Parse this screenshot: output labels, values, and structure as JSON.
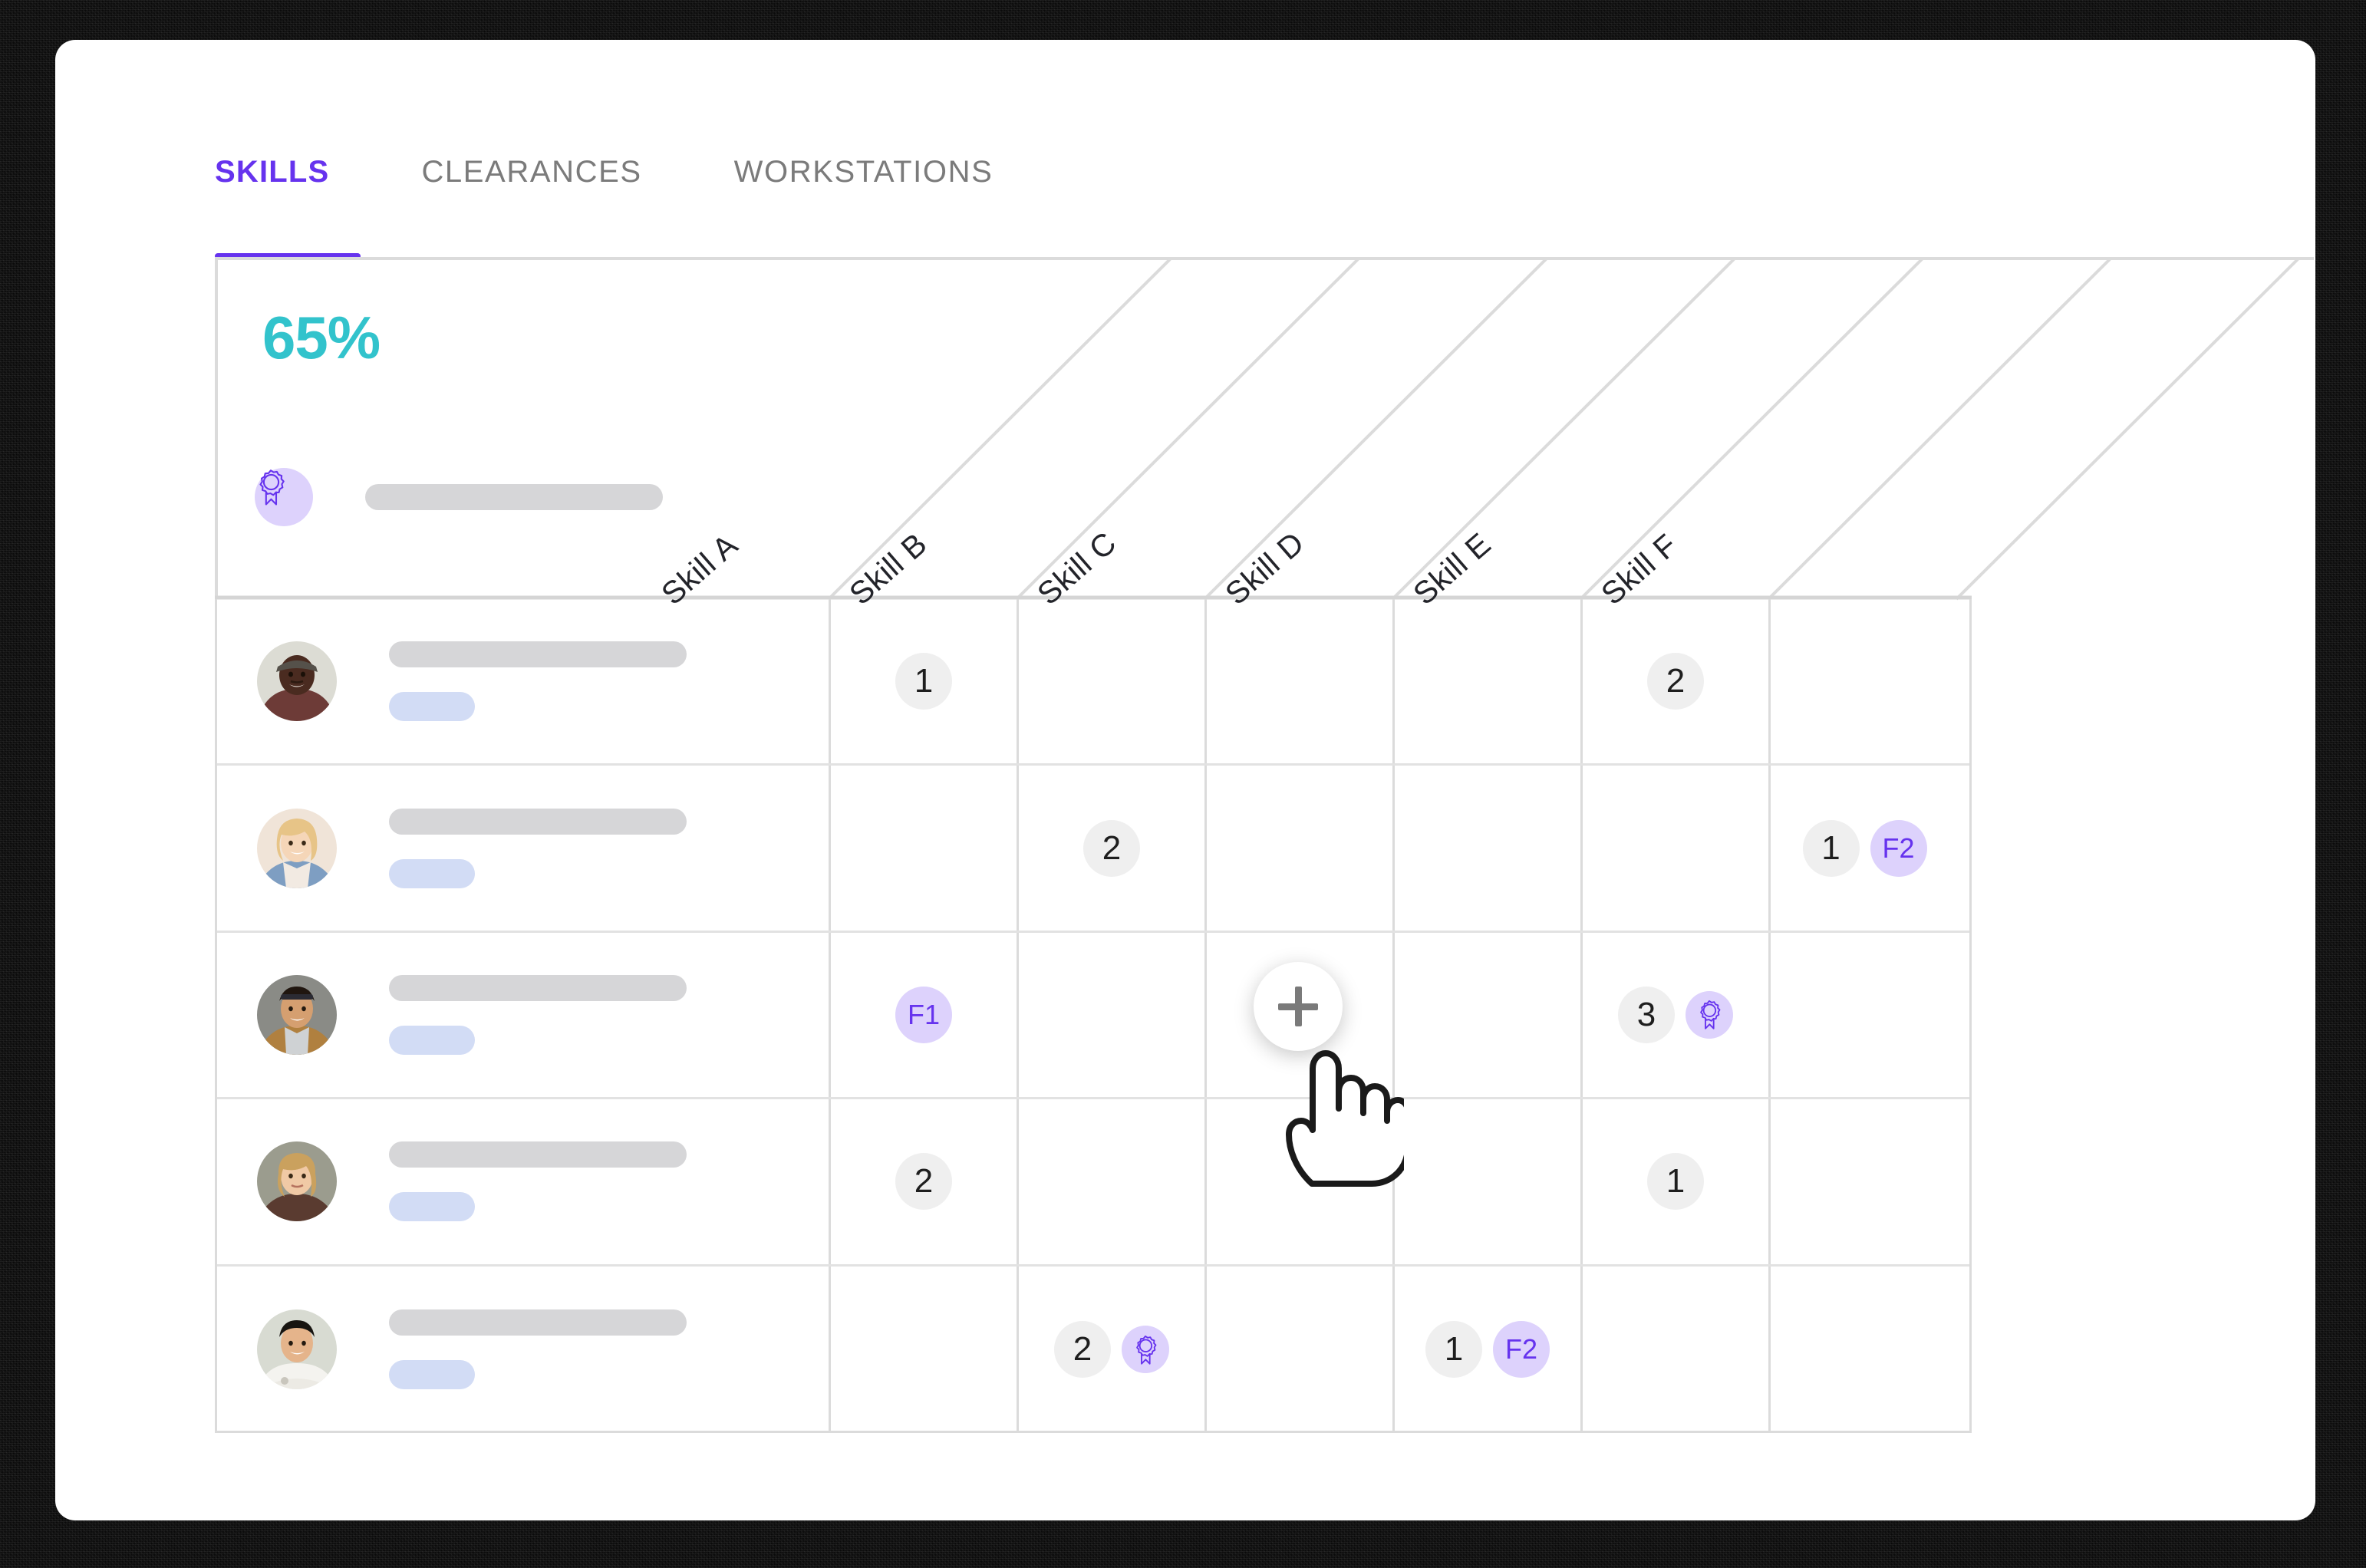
{
  "tabs": [
    {
      "label": "SKILLS",
      "active": true
    },
    {
      "label": "CLEARANCES",
      "active": false
    },
    {
      "label": "WORKSTATIONS",
      "active": false
    }
  ],
  "summary": {
    "percent": "65%",
    "percent_color": "#32c3cc"
  },
  "colors": {
    "accent_purple": "#6633ee",
    "badge_purple_bg": "#ddd2fc",
    "badge_gray_bg": "#efefef",
    "bar_gray": "#d6d6d8",
    "bar_blue": "#d2dcf5",
    "grid_line": "#dbdbdb",
    "teal": "#32c3cc"
  },
  "header_row": {
    "icon": "award-ribbon-icon",
    "name_placeholder": ""
  },
  "columns": [
    {
      "label": "Skill A"
    },
    {
      "label": "Skill B"
    },
    {
      "label": "Skill C"
    },
    {
      "label": "Skill D"
    },
    {
      "label": "Skill E"
    },
    {
      "label": "Skill F"
    }
  ],
  "rows": [
    {
      "avatar": "person-1-avatar",
      "cells": [
        {
          "num": "1"
        },
        {},
        {},
        {},
        {
          "num": "2"
        },
        {}
      ]
    },
    {
      "avatar": "person-2-avatar",
      "cells": [
        {},
        {
          "num": "2"
        },
        {},
        {},
        {},
        {
          "num": "1",
          "flag": "F2"
        }
      ]
    },
    {
      "avatar": "person-3-avatar",
      "cells": [
        {
          "flag": "F1"
        },
        {},
        {},
        {},
        {
          "num": "3",
          "award": true
        },
        {}
      ]
    },
    {
      "avatar": "person-4-avatar",
      "cells": [
        {
          "num": "2"
        },
        {},
        {},
        {},
        {
          "num": "1"
        },
        {}
      ]
    },
    {
      "avatar": "person-5-avatar",
      "cells": [
        {},
        {
          "num": "2",
          "award": true
        },
        {},
        {
          "num": "1",
          "flag": "F2"
        },
        {},
        {}
      ]
    }
  ],
  "add_button": {
    "icon": "plus-icon",
    "label": "+"
  },
  "cursor": {
    "icon": "hand-pointer-cursor"
  }
}
